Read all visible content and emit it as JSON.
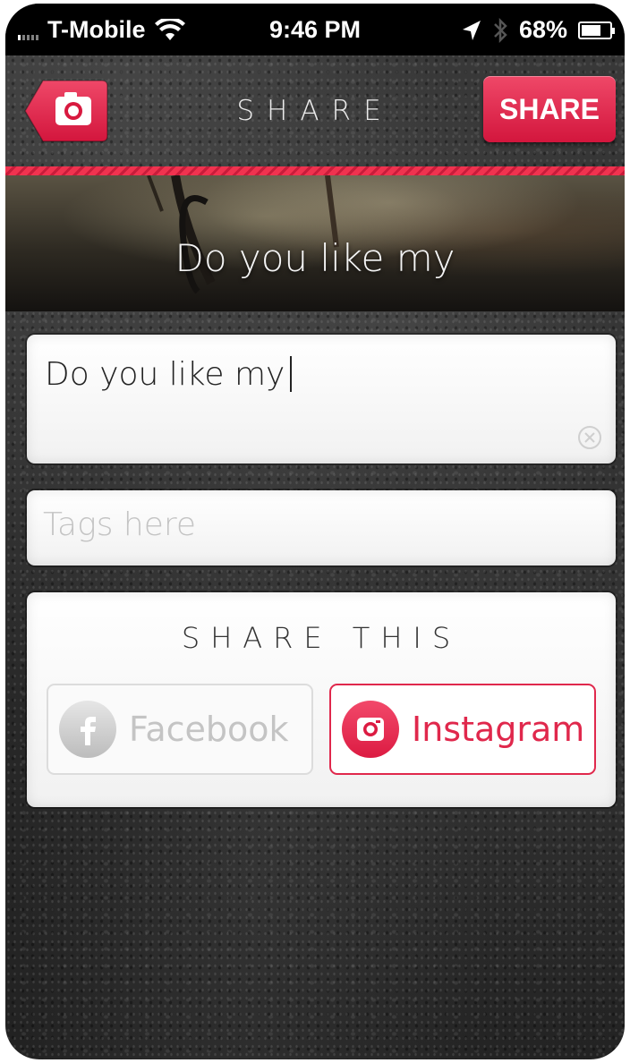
{
  "status_bar": {
    "carrier": "T-Mobile",
    "time": "9:46 PM",
    "battery": "68%",
    "icons": [
      "signal-icon",
      "wifi-icon",
      "location-arrow-icon",
      "bluetooth-icon",
      "battery-icon"
    ]
  },
  "nav": {
    "title": "SHARE",
    "share_label": "SHARE",
    "back_icon": "camera-icon"
  },
  "banner": {
    "caption": "Do you like my"
  },
  "caption_field": {
    "value": "Do you like my"
  },
  "tags_field": {
    "value": "",
    "placeholder": "Tags here"
  },
  "share_this": {
    "title": "SHARE THIS",
    "options": [
      {
        "label": "Facebook",
        "icon": "facebook-icon",
        "selected": false
      },
      {
        "label": "Instagram",
        "icon": "instagram-icon",
        "selected": true
      }
    ]
  },
  "colors": {
    "accent": "#e0284c",
    "accent_button": "#d3163d",
    "background": "#2b2b2b"
  }
}
